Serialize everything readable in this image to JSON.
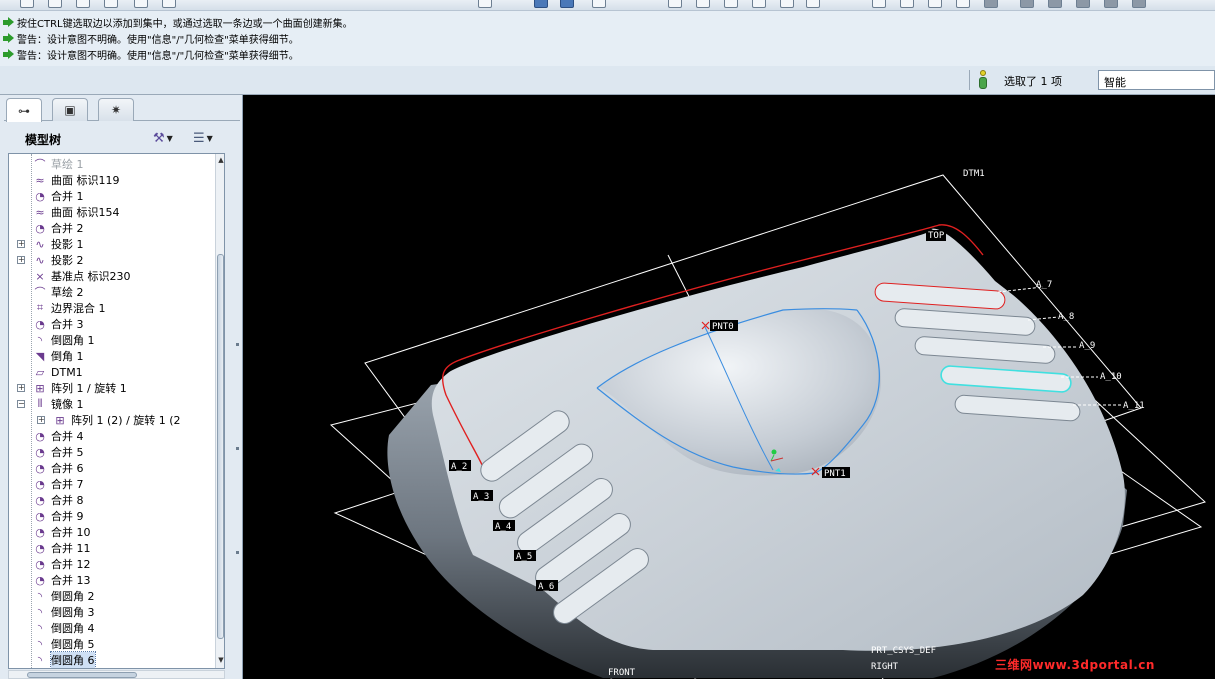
{
  "messages": [
    "按住CTRL键选取边以添加到集中，或通过选取一条边或一个曲面创建新集。",
    "警告：设计意图不明确。使用\"信息\"/\"几何检查\"菜单获得细节。",
    "警告：设计意图不明确。使用\"信息\"/\"几何检查\"菜单获得细节。"
  ],
  "status": {
    "selection_text": "选取了 1 项",
    "filter_value": "智能"
  },
  "panel": {
    "tree_title": "模型树"
  },
  "tree": [
    {
      "label": "草绘 1",
      "icon": "sketch-icon",
      "glyph": "⌒",
      "expand": false,
      "indent": 0,
      "dim": true
    },
    {
      "label": "曲面 标识119",
      "icon": "surface-icon",
      "glyph": "≈",
      "expand": false,
      "indent": 0
    },
    {
      "label": "合并 1",
      "icon": "merge-icon",
      "glyph": "◔",
      "expand": false,
      "indent": 0
    },
    {
      "label": "曲面 标识154",
      "icon": "surface-icon",
      "glyph": "≈",
      "expand": false,
      "indent": 0
    },
    {
      "label": "合并 2",
      "icon": "merge-icon",
      "glyph": "◔",
      "expand": false,
      "indent": 0
    },
    {
      "label": "投影 1",
      "icon": "projection-icon",
      "glyph": "∿",
      "expand": true,
      "indent": 0
    },
    {
      "label": "投影 2",
      "icon": "projection-icon",
      "glyph": "∿",
      "expand": true,
      "indent": 0
    },
    {
      "label": "基准点 标识230",
      "icon": "datum-point-icon",
      "glyph": "×",
      "expand": false,
      "indent": 0
    },
    {
      "label": "草绘 2",
      "icon": "sketch-icon",
      "glyph": "⌒",
      "expand": false,
      "indent": 0
    },
    {
      "label": "边界混合 1",
      "icon": "boundary-blend-icon",
      "glyph": "⌗",
      "expand": false,
      "indent": 0
    },
    {
      "label": "合并 3",
      "icon": "merge-icon",
      "glyph": "◔",
      "expand": false,
      "indent": 0
    },
    {
      "label": "倒圆角 1",
      "icon": "round-icon",
      "glyph": "◝",
      "expand": false,
      "indent": 0
    },
    {
      "label": "倒角 1",
      "icon": "chamfer-icon",
      "glyph": "◥",
      "expand": false,
      "indent": 0
    },
    {
      "label": "DTM1",
      "icon": "datum-plane-icon",
      "glyph": "▱",
      "expand": false,
      "indent": 0
    },
    {
      "label": "阵列 1 / 旋转 1",
      "icon": "pattern-icon",
      "glyph": "⊞",
      "expand": true,
      "indent": 0
    },
    {
      "label": "镜像 1",
      "icon": "mirror-icon",
      "glyph": "⫴",
      "expand": true,
      "expanded": true,
      "indent": 0
    },
    {
      "label": "阵列 1 (2) / 旋转 1 (2",
      "icon": "pattern-icon",
      "glyph": "⊞",
      "expand": true,
      "indent": 1
    },
    {
      "label": "合并 4",
      "icon": "merge-icon",
      "glyph": "◔",
      "expand": false,
      "indent": 0
    },
    {
      "label": "合并 5",
      "icon": "merge-icon",
      "glyph": "◔",
      "expand": false,
      "indent": 0
    },
    {
      "label": "合并 6",
      "icon": "merge-icon",
      "glyph": "◔",
      "expand": false,
      "indent": 0
    },
    {
      "label": "合并 7",
      "icon": "merge-icon",
      "glyph": "◔",
      "expand": false,
      "indent": 0
    },
    {
      "label": "合并 8",
      "icon": "merge-icon",
      "glyph": "◔",
      "expand": false,
      "indent": 0
    },
    {
      "label": "合并 9",
      "icon": "merge-icon",
      "glyph": "◔",
      "expand": false,
      "indent": 0
    },
    {
      "label": "合并 10",
      "icon": "merge-icon",
      "glyph": "◔",
      "expand": false,
      "indent": 0
    },
    {
      "label": "合并 11",
      "icon": "merge-icon",
      "glyph": "◔",
      "expand": false,
      "indent": 0
    },
    {
      "label": "合并 12",
      "icon": "merge-icon",
      "glyph": "◔",
      "expand": false,
      "indent": 0
    },
    {
      "label": "合并 13",
      "icon": "merge-icon",
      "glyph": "◔",
      "expand": false,
      "indent": 0
    },
    {
      "label": "倒圆角 2",
      "icon": "round-icon",
      "glyph": "◝",
      "expand": false,
      "indent": 0
    },
    {
      "label": "倒圆角 3",
      "icon": "round-icon",
      "glyph": "◝",
      "expand": false,
      "indent": 0
    },
    {
      "label": "倒圆角 4",
      "icon": "round-icon",
      "glyph": "◝",
      "expand": false,
      "indent": 0
    },
    {
      "label": "倒圆角 5",
      "icon": "round-icon",
      "glyph": "◝",
      "expand": false,
      "indent": 0
    },
    {
      "label": "倒圆角 6",
      "icon": "round-icon",
      "glyph": "◝",
      "expand": false,
      "indent": 0,
      "selected": true
    }
  ],
  "viewport": {
    "datum_labels": {
      "dtm1": "DTM1",
      "top": "TOP",
      "front": "FRONT",
      "right": "RIGHT",
      "csys": "PRT_CSYS_DEF",
      "pnt0": "PNT0",
      "pnt1": "PNT1",
      "a2": "A_2",
      "a3": "A_3",
      "a4": "A_4",
      "a5": "A_5",
      "a6": "A_6",
      "a7": "A_7",
      "a8": "A_8",
      "a9": "A_9",
      "a10": "A_10",
      "a11": "A_11"
    },
    "watermark": "三维网www.3dportal.cn"
  },
  "colors": {
    "viewport_bg": "#000000",
    "part_body": "#b8c2cc",
    "sketch_curve": "#3a8de0",
    "highlight_edge": "#e02020",
    "selection_cyan": "#40e0e0",
    "datum_plane": "#ffffff"
  }
}
